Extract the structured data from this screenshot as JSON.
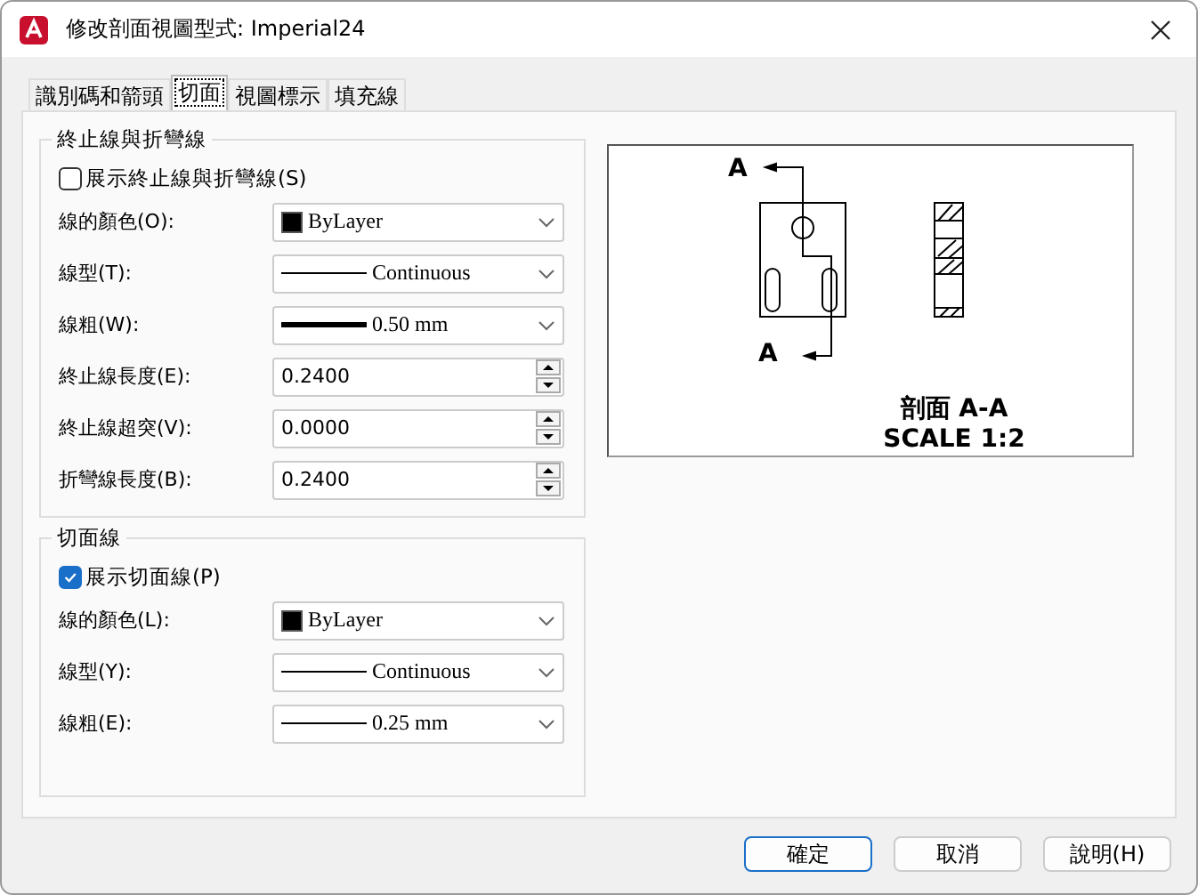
{
  "window": {
    "title": "修改剖面視圖型式: Imperial24"
  },
  "tabs": [
    {
      "label": "識別碼和箭頭",
      "selected": false
    },
    {
      "label": "切面",
      "selected": true
    },
    {
      "label": "視圖標示",
      "selected": false
    },
    {
      "label": "填充線",
      "selected": false
    }
  ],
  "groups": [
    {
      "title": "終止線與折彎線",
      "checkbox": {
        "label": "展示終止線與折彎線(S)",
        "checked": false
      },
      "fields": [
        {
          "label": "線的顏色(O):",
          "kind": "color",
          "value": "ByLayer"
        },
        {
          "label": "線型(T):",
          "kind": "linetype",
          "value": "Continuous"
        },
        {
          "label": "線粗(W):",
          "kind": "lineweight-thick",
          "value": "0.50 mm"
        },
        {
          "label": "終止線長度(E):",
          "kind": "spinner",
          "value": "0.2400"
        },
        {
          "label": "終止線超突(V):",
          "kind": "spinner",
          "value": "0.0000"
        },
        {
          "label": "折彎線長度(B):",
          "kind": "spinner",
          "value": "0.2400"
        }
      ]
    },
    {
      "title": "切面線",
      "checkbox": {
        "label": "展示切面線(P)",
        "checked": true
      },
      "fields": [
        {
          "label": "線的顏色(L):",
          "kind": "color",
          "value": "ByLayer"
        },
        {
          "label": "線型(Y):",
          "kind": "linetype",
          "value": "Continuous"
        },
        {
          "label": "線粗(E):",
          "kind": "lineweight-thin",
          "value": "0.25 mm"
        }
      ]
    }
  ],
  "preview": {
    "top_label": "A",
    "bottom_label": "A",
    "caption": "剖面 A-A",
    "scale": "SCALE 1:2"
  },
  "buttons": [
    "確定",
    "取消",
    "說明(H)"
  ]
}
